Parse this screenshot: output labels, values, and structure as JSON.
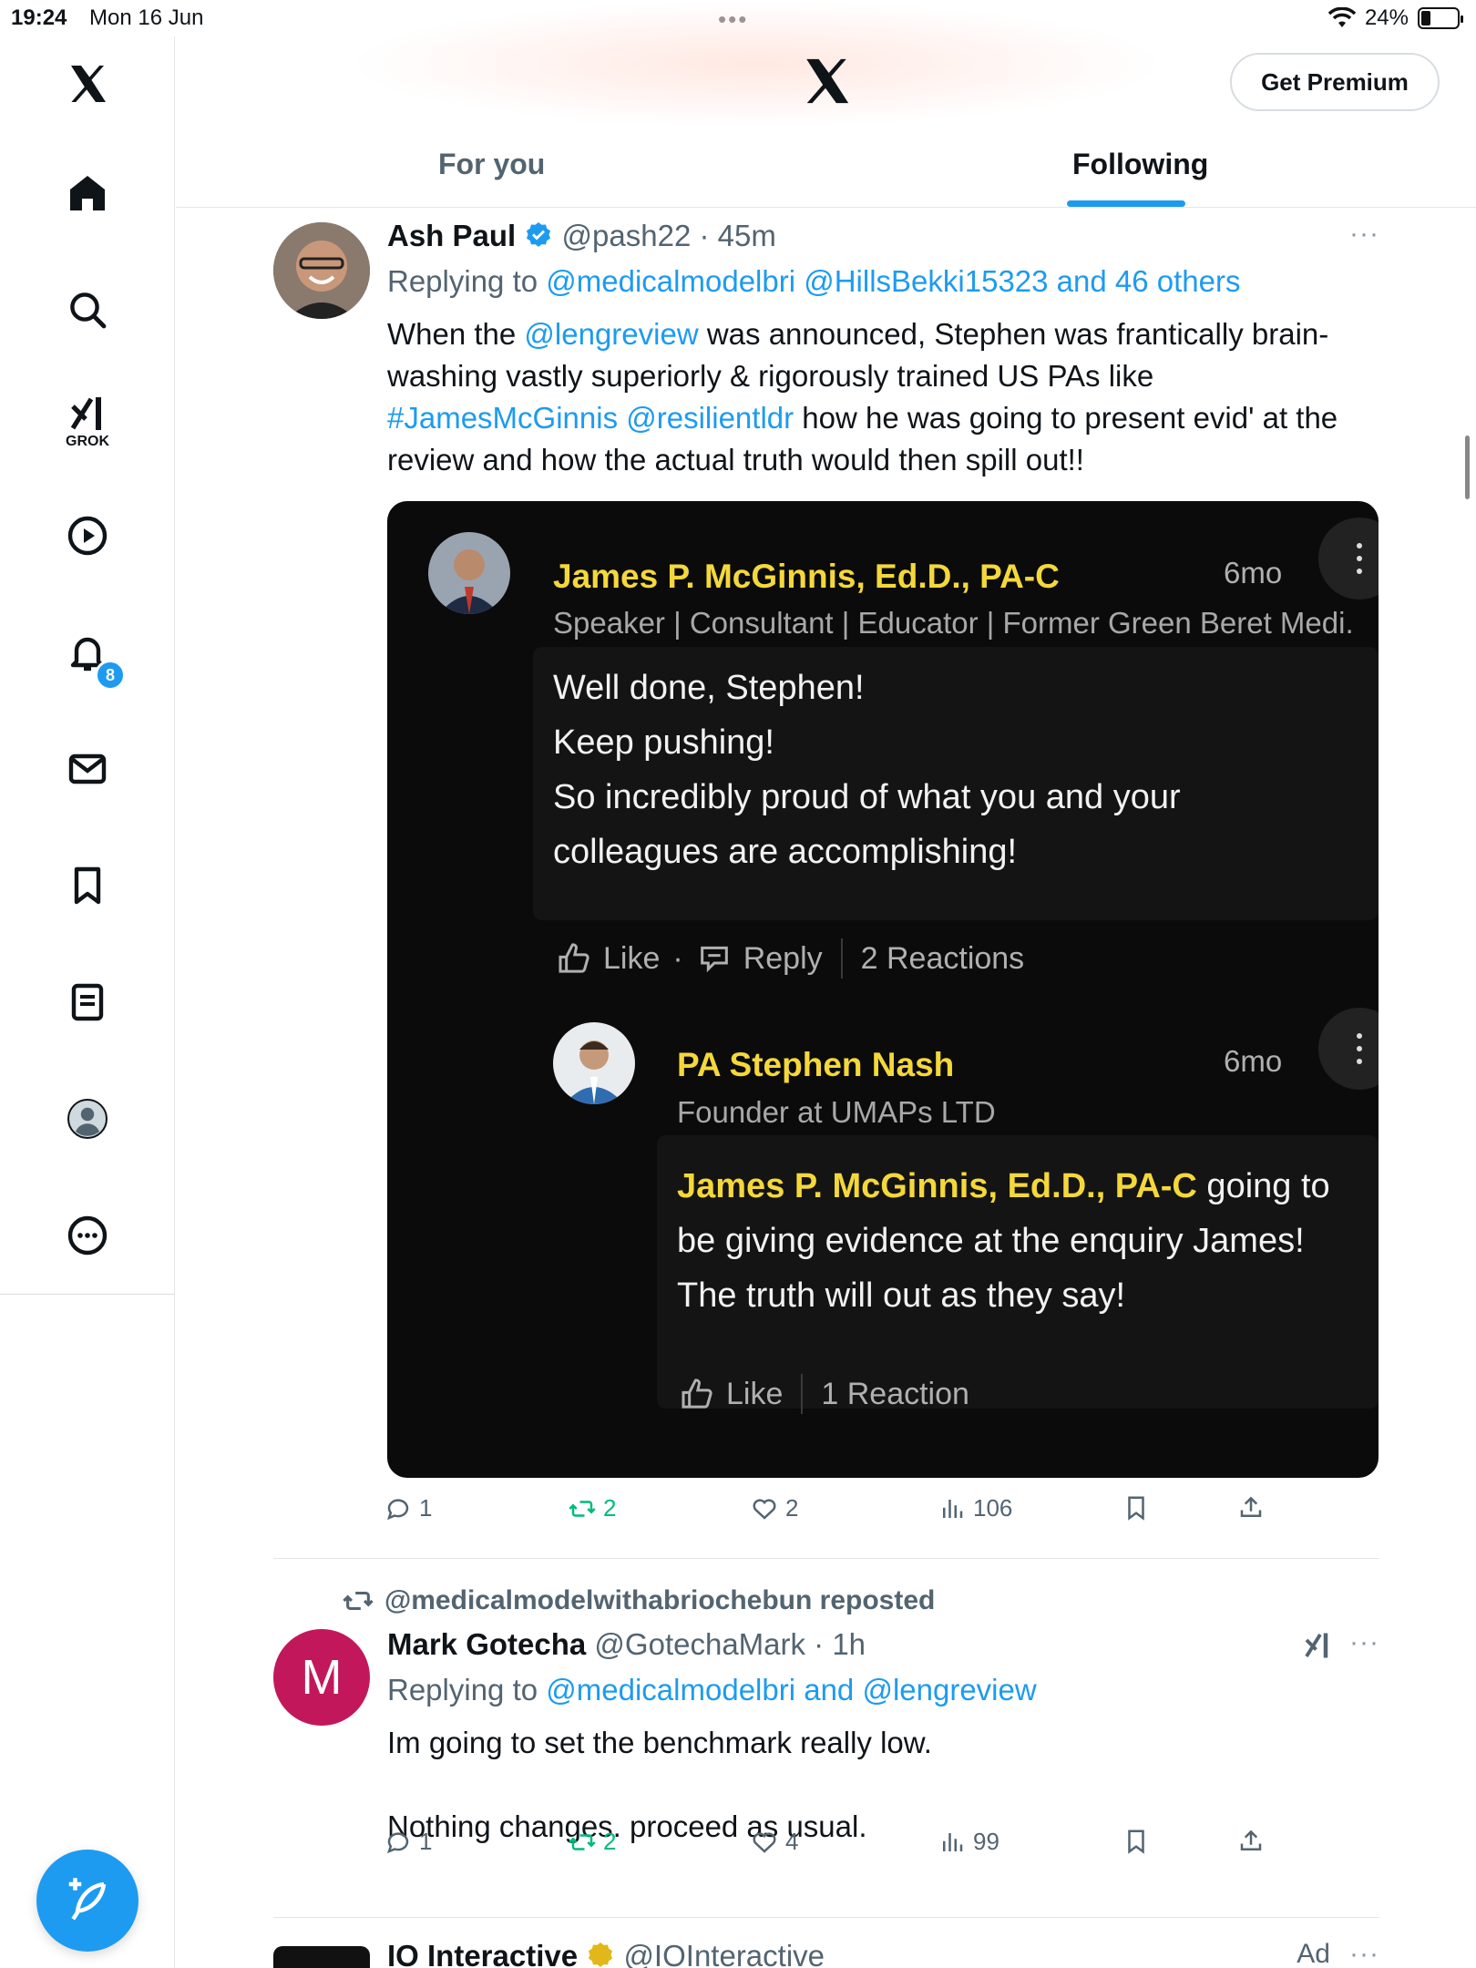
{
  "status_bar": {
    "time": "19:24",
    "date": "Mon 16 Jun",
    "dots": "•••",
    "battery": "24%"
  },
  "sidebar": {
    "grok_label": "GROK",
    "notification_count": "8"
  },
  "header": {
    "premium_button": "Get Premium"
  },
  "tabs": [
    {
      "label": "For you"
    },
    {
      "label": "Following"
    }
  ],
  "tweets": [
    {
      "name": "Ash Paul",
      "handle": "@pash22 · 45m",
      "replying_prefix": "Replying to",
      "replying_to": "@medicalmodelbri @HillsBekki15323 and 46 others",
      "body": [
        {
          "text": "When the ",
          "link": false
        },
        {
          "text": "@lengreview",
          "link": true
        },
        {
          "text": " was announced, Stephen was frantically brain-washing vastly superiorly & rigorously trained US PAs like ",
          "link": false
        },
        {
          "text": "#JamesMcGinnis @resilientldr",
          "link": true
        },
        {
          "text": " how he was going to present evid' at the review and how the actual truth would then spill out!!",
          "link": false
        }
      ],
      "more": "···",
      "actions": {
        "replies": "1",
        "reposts": "2",
        "likes": "2",
        "views": "106"
      },
      "embed": {
        "comment1": {
          "name": "James P. McGinnis, Ed.D., PA-C",
          "time": "6mo",
          "headline": "Speaker | Consultant | Educator | Former Green Beret Medi...",
          "text": "Well done, Stephen!\nKeep pushing!\nSo incredibly proud of what you and your colleagues are accomplishing!",
          "like": "Like",
          "dot": "·",
          "reply": "Reply",
          "reactions": "2 Reactions"
        },
        "comment2": {
          "name": "PA Stephen Nash",
          "time": "6mo",
          "headline": "Founder at UMAPs LTD",
          "mention": "James P. McGinnis, Ed.D., PA-C",
          "text": " going to be giving evidence at the enquiry James! The truth will out as they say!",
          "like": "Like",
          "reactions": "1 Reaction"
        }
      }
    },
    {
      "repost_label": "@medicalmodelwithabriochebun reposted",
      "name": "Mark Gotecha",
      "handle": "@GotechaMark · 1h",
      "avatar_letter": "M",
      "replying_prefix": "Replying to",
      "replying_to": "@medicalmodelbri and @lengreview",
      "body_line1": "Im going to set the benchmark really low.",
      "body_line2": "Nothing changes. proceed as usual.",
      "more": "···",
      "actions": {
        "replies": "1",
        "reposts": "2",
        "likes": "4",
        "views": "99"
      }
    },
    {
      "name": "IO Interactive",
      "handle": "@IOInteractive",
      "ad_label": "Ad",
      "more": "···"
    }
  ],
  "colors": {
    "accent": "#1d9bf0",
    "repost_green": "#00ba7c",
    "linkedin_yellow": "#f4d83a",
    "avatar_magenta": "#c2185b"
  }
}
